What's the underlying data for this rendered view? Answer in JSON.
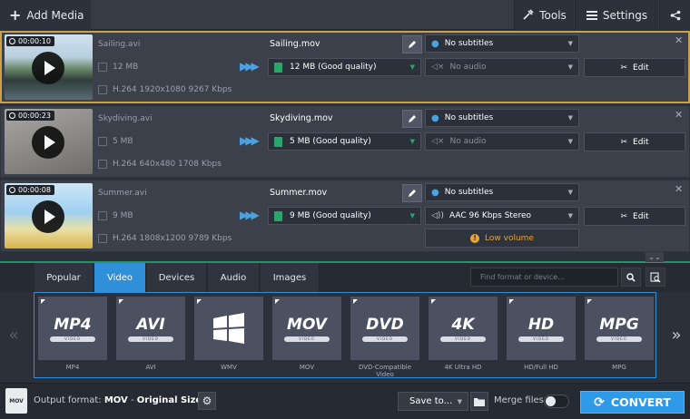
{
  "toolbar": {
    "add_media": "Add Media",
    "tools": "Tools",
    "settings": "Settings"
  },
  "files": [
    {
      "duration": "00:00:10",
      "source_name": "Sailing.avi",
      "source_size": "12 MB",
      "source_codec": "H.264 1920x1080 9267 Kbps",
      "output_name": "Sailing.mov",
      "output_size": "12 MB (Good quality)",
      "subtitles": "No subtitles",
      "audio": "No audio",
      "edit_label": "Edit",
      "selected": true
    },
    {
      "duration": "00:00:23",
      "source_name": "Skydiving.avi",
      "source_size": "5 MB",
      "source_codec": "H.264 640x480 1708 Kbps",
      "output_name": "Skydiving.mov",
      "output_size": "5 MB (Good quality)",
      "subtitles": "No subtitles",
      "audio": "No audio",
      "edit_label": "Edit",
      "selected": false
    },
    {
      "duration": "00:00:08",
      "source_name": "Summer.avi",
      "source_size": "9 MB",
      "source_codec": "H.264 1808x1200 9789 Kbps",
      "output_name": "Summer.mov",
      "output_size": "9 MB (Good quality)",
      "subtitles": "No subtitles",
      "audio": "AAC 96 Kbps Stereo",
      "edit_label": "Edit",
      "warning": "Low volume",
      "selected": false
    }
  ],
  "tabs": [
    "Popular",
    "Video",
    "Devices",
    "Audio",
    "Images"
  ],
  "active_tab": "Video",
  "search": {
    "placeholder": "Find format or device..."
  },
  "formats": [
    {
      "badge": "MP4",
      "sub": "VIDEO",
      "label": "MP4"
    },
    {
      "badge": "AVI",
      "sub": "VIDEO",
      "label": "AVI"
    },
    {
      "badge": "",
      "sub": "",
      "label": "WMV",
      "icon": "windows-logo-icon"
    },
    {
      "badge": "MOV",
      "sub": "VIDEO",
      "label": "MOV"
    },
    {
      "badge": "DVD",
      "sub": "VIDEO",
      "label": "DVD-Compatible Video"
    },
    {
      "badge": "4K",
      "sub": "VIDEO",
      "label": "4K Ultra HD"
    },
    {
      "badge": "HD",
      "sub": "VIDEO",
      "label": "HD/Full HD"
    },
    {
      "badge": "MPG",
      "sub": "VIDEO",
      "label": "MPG"
    }
  ],
  "footer": {
    "output_prefix": "Output format:",
    "output_format": "MOV",
    "output_sep": " - ",
    "output_preset": "Original Size",
    "output_icon_text": "MOV",
    "save_to": "Save to...",
    "merge_files": "Merge files:",
    "convert": "CONVERT"
  },
  "colors": {
    "accent_blue": "#2f8fd8",
    "selected_border": "#c8a24a",
    "warning": "#e9a33a",
    "doc_green": "#2aa66a"
  }
}
